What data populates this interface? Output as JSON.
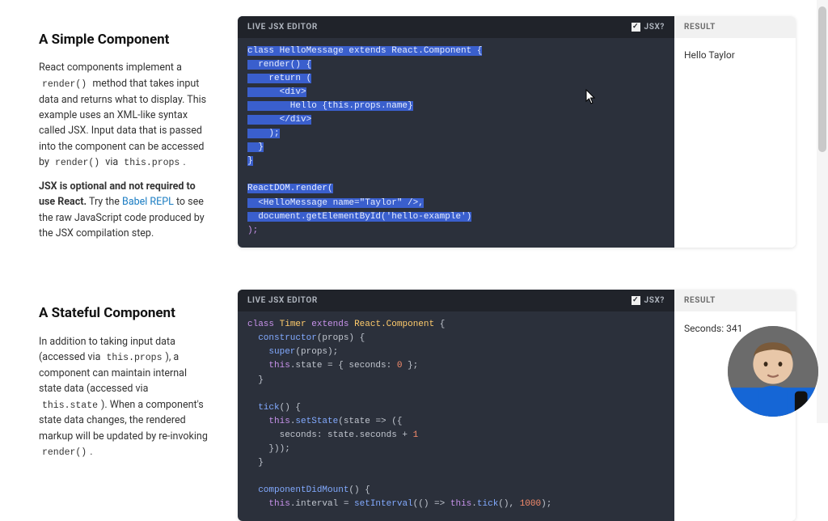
{
  "example1": {
    "title": "A Simple Component",
    "p1_a": "React components implement a ",
    "p1_code1": "render()",
    "p1_b": " method that takes input data and returns what to display. This example uses an XML-like syntax called JSX. Input data that is passed into the component can be accessed by ",
    "p1_code2": "render()",
    "p1_c": " via ",
    "p1_code3": "this.props",
    "p1_d": ".",
    "p2_strong": "JSX is optional and not required to use React.",
    "p2_a": " Try the ",
    "p2_link": "Babel REPL",
    "p2_b": " to see the raw JavaScript code produced by the JSX compilation step.",
    "editor_label": "LIVE JSX EDITOR",
    "jsx_label": "JSX?",
    "result_label": "RESULT",
    "result_text": "Hello Taylor",
    "code": {
      "l1": "class HelloMessage extends React.Component {",
      "l2": "  render() {",
      "l3": "    return (",
      "l4": "      <div>",
      "l5": "        Hello {this.props.name}",
      "l6": "      </div>",
      "l7": "    );",
      "l8": "  }",
      "l9": "}",
      "l10": "",
      "l11": "ReactDOM.render(",
      "l12": "  <HelloMessage name=\"Taylor\" />,",
      "l13": "  document.getElementById('hello-example')",
      "l14": ");"
    }
  },
  "example2": {
    "title": "A Stateful Component",
    "p1_a": "In addition to taking input data (accessed via ",
    "p1_code1": "this.props",
    "p1_b": "), a component can maintain internal state data (accessed via ",
    "p1_code2": "this.state",
    "p1_c": "). When a component's state data changes, the rendered markup will be updated by re-invoking ",
    "p1_code3": "render()",
    "p1_d": ".",
    "editor_label": "LIVE JSX EDITOR",
    "jsx_label": "JSX?",
    "result_label": "RESULT",
    "result_text": "Seconds: 341",
    "code": {
      "l1": "class Timer extends React.Component {",
      "l2": "  constructor(props) {",
      "l3": "    super(props);",
      "l4": "    this.state = { seconds: 0 };",
      "l5": "  }",
      "l6": "",
      "l7": "  tick() {",
      "l8": "    this.setState(state => ({",
      "l9": "      seconds: state.seconds + 1",
      "l10": "    }));",
      "l11": "  }",
      "l12": "",
      "l13": "  componentDidMount() {",
      "l14": "    this.interval = setInterval(() => this.tick(), 1000);"
    }
  }
}
